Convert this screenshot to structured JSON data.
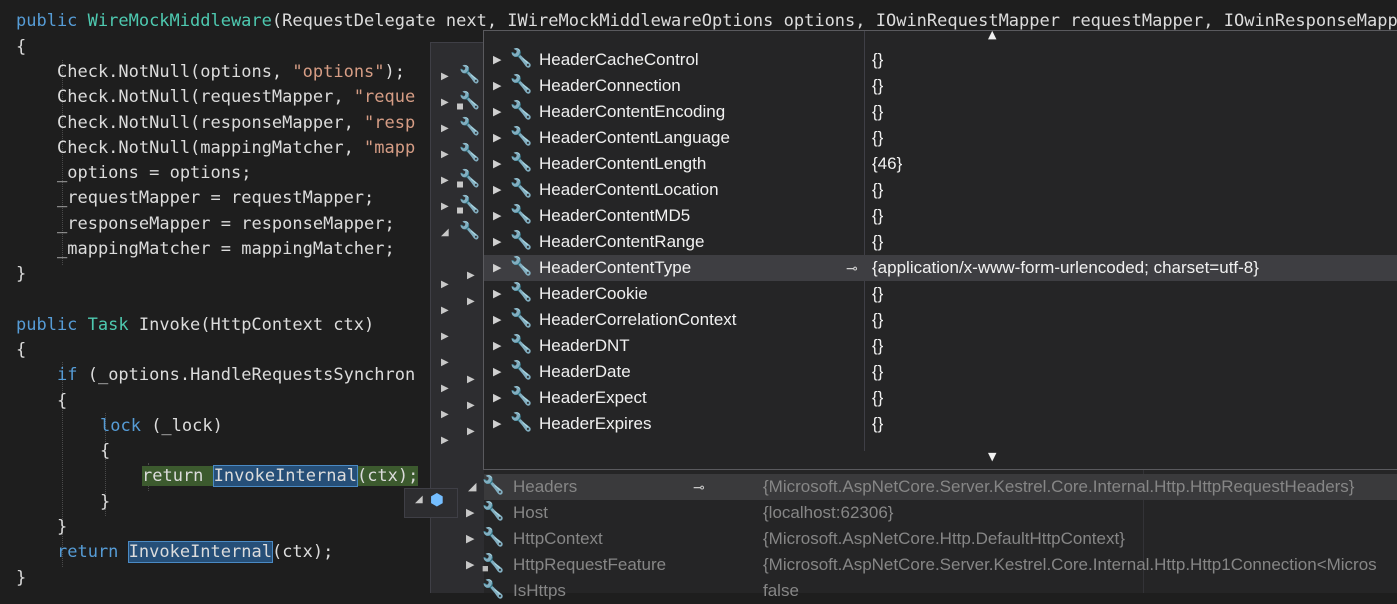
{
  "code": {
    "line1": {
      "kw": "public ",
      "cls": "WireMockMiddleware",
      "rest": "(RequestDelegate next, IWireMockMiddlewareOptions options, IOwinRequestMapper requestMapper, IOwinResponseMapper"
    },
    "line2": "{",
    "line3": {
      "a": "Check.NotNull(options, ",
      "s": "\"options\"",
      "b": ");"
    },
    "line4": {
      "a": "Check.NotNull(requestMapper, ",
      "s": "\"reque"
    },
    "line5": {
      "a": "Check.NotNull(responseMapper, ",
      "s": "\"resp"
    },
    "line6": {
      "a": "Check.NotNull(mappingMatcher, ",
      "s": "\"mapp"
    },
    "line7": "_options = options;",
    "line8": "_requestMapper = requestMapper;",
    "line9": "_responseMapper = responseMapper;",
    "line10": "_mappingMatcher = mappingMatcher;",
    "line11": "}",
    "line12": {
      "kw": "public ",
      "ty": "Task ",
      "rest": "Invoke(HttpContext ctx)"
    },
    "line13": "{",
    "line14": {
      "kw": "if ",
      "rest": "(_options.HandleRequestsSynchron"
    },
    "line15": "{",
    "line16": {
      "kw": "lock ",
      "rest": "(_lock)"
    },
    "line17": "{",
    "line18": {
      "kw": "return ",
      "ref": "InvokeInternal",
      "rest": "(ctx);"
    },
    "line19": "}",
    "line20": "}",
    "line21": {
      "kw": "return ",
      "ref": "InvokeInternal",
      "rest": "(ctx);"
    },
    "line22": "}"
  },
  "inner_tip": {
    "rows": [
      {
        "name": "HeaderCacheControl",
        "value": "{}"
      },
      {
        "name": "HeaderConnection",
        "value": "{}"
      },
      {
        "name": "HeaderContentEncoding",
        "value": "{}"
      },
      {
        "name": "HeaderContentLanguage",
        "value": "{}"
      },
      {
        "name": "HeaderContentLength",
        "value": "{46}"
      },
      {
        "name": "HeaderContentLocation",
        "value": "{}"
      },
      {
        "name": "HeaderContentMD5",
        "value": "{}"
      },
      {
        "name": "HeaderContentRange",
        "value": "{}"
      },
      {
        "name": "HeaderContentType",
        "value": "{application/x-www-form-urlencoded; charset=utf-8}"
      },
      {
        "name": "HeaderCookie",
        "value": "{}"
      },
      {
        "name": "HeaderCorrelationContext",
        "value": "{}"
      },
      {
        "name": "HeaderDNT",
        "value": "{}"
      },
      {
        "name": "HeaderDate",
        "value": "{}"
      },
      {
        "name": "HeaderExpect",
        "value": "{}"
      },
      {
        "name": "HeaderExpires",
        "value": "{}"
      }
    ],
    "selected_index": 8
  },
  "outer_tip": {
    "rows": [
      {
        "name": "Headers",
        "value": "{Microsoft.AspNetCore.Server.Kestrel.Core.Internal.Http.HttpRequestHeaders}",
        "expanded": true
      },
      {
        "name": "Host",
        "value": "{localhost:62306}"
      },
      {
        "name": "HttpContext",
        "value": "{Microsoft.AspNetCore.Http.DefaultHttpContext}"
      },
      {
        "name": "HttpRequestFeature",
        "value": "{Microsoft.AspNetCore.Server.Kestrel.Core.Internal.Http.Http1Connection<Micros"
      },
      {
        "name": "IsHttps",
        "value": "false"
      }
    ]
  },
  "icons": {
    "expand": "▶",
    "expanded": "◢",
    "wrench": "🔧",
    "pin": "⊸",
    "scroll_up": "▲",
    "scroll_down": "▼",
    "cube": "⬢"
  }
}
